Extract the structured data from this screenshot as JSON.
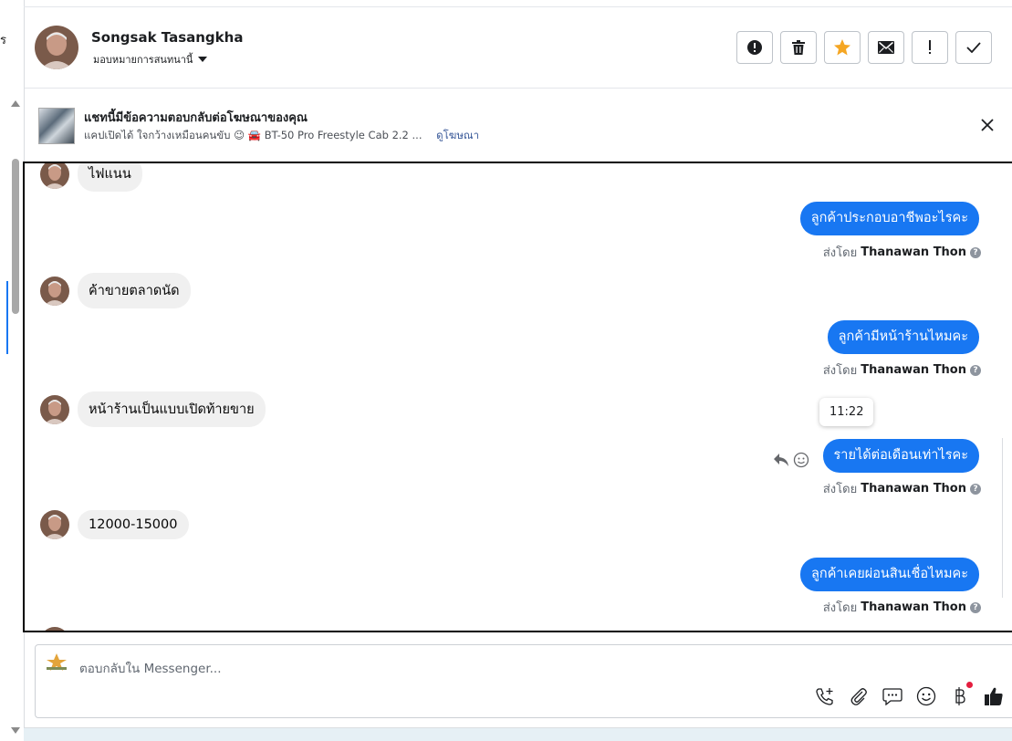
{
  "left_strip": {
    "cut_letter": "ร"
  },
  "header": {
    "contact_name": "Songsak Tasangkha",
    "assign_label": "มอบหมายการสนทนานี้",
    "actions": [
      {
        "name": "mark-spam-button",
        "icon": "exclamation-circle-icon"
      },
      {
        "name": "delete-button",
        "icon": "trash-icon"
      },
      {
        "name": "star-button",
        "icon": "star-icon"
      },
      {
        "name": "mark-unread-button",
        "icon": "envelope-icon"
      },
      {
        "name": "follow-up-button",
        "icon": "exclamation-icon"
      },
      {
        "name": "mark-done-button",
        "icon": "check-icon"
      }
    ],
    "star_color": "#f5a623"
  },
  "ad_banner": {
    "title": "แชทนี้มีข้อความตอบกลับต่อโฆษณาของคุณ",
    "subtitle": "แคปเปิดได้ ใจกว้างเหมือนคนขับ 😉 🚘 BT-50 Pro Freestyle Cab 2.2 ...",
    "link": "ดูโฆษณา"
  },
  "messages": {
    "incoming": [
      {
        "text": "ไฟแนน"
      },
      {
        "text": "ค้าขายตลาดนัด"
      },
      {
        "text": "หน้าร้านเป็นแบบเปิดท้ายขาย"
      },
      {
        "text": "12000-15000"
      }
    ],
    "outgoing": [
      {
        "text": "ลูกค้าประกอบอาชีพอะไรคะ",
        "sent_by_prefix": "ส่งโดย",
        "sender": "Thanawan Thon"
      },
      {
        "text": "ลูกค้ามีหน้าร้านไหมคะ",
        "sent_by_prefix": "ส่งโดย",
        "sender": "Thanawan Thon"
      },
      {
        "text": "รายได้ต่อเดือนเท่าไรคะ",
        "sent_by_prefix": "ส่งโดย",
        "sender": "Thanawan Thon"
      },
      {
        "text": "ลูกค้าเคยผ่อนสินเชื่อไหมคะ",
        "sent_by_prefix": "ส่งโดย",
        "sender": "Thanawan Thon"
      }
    ],
    "tooltip_time": "11:22",
    "bubble_color": "#1877f2"
  },
  "composer": {
    "placeholder": "ตอบกลับใน Messenger...",
    "tools": [
      "phone-plus-icon",
      "paperclip-icon",
      "chat-bubble-icon",
      "smiley-icon",
      "baht-icon",
      "thumbs-up-icon"
    ]
  }
}
